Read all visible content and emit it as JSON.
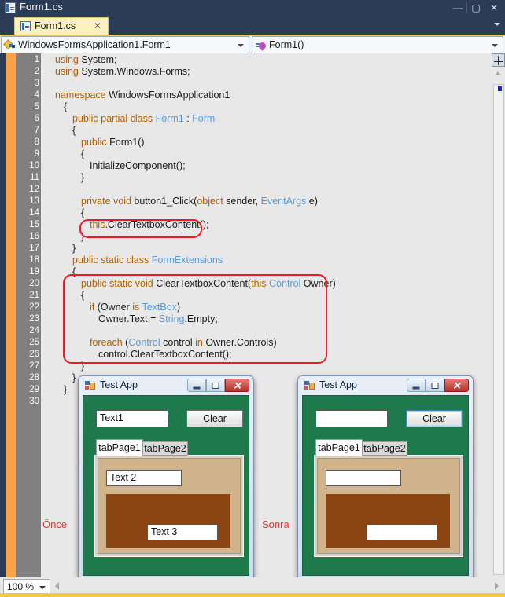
{
  "window": {
    "title": "Form1.cs",
    "icon": "csharp-file-icon",
    "controls": {
      "minimize": "—",
      "maximize": "▢",
      "close": "✕"
    }
  },
  "tabstrip": {
    "tabs": [
      {
        "label": "Form1.cs",
        "close": "✕",
        "icon": "csharp-file-icon"
      }
    ],
    "overflow": "chevron-down-icon"
  },
  "navbar": {
    "class_combo": {
      "value": "WindowsFormsApplication1.Form1",
      "icon": "class-icon"
    },
    "member_combo": {
      "value": "Form1()",
      "icon": "method-icon"
    }
  },
  "editor": {
    "zoom": "100 %",
    "lines": [
      {
        "n": "1",
        "indent": 0,
        "tokens": [
          {
            "t": "using ",
            "c": "kw"
          },
          {
            "t": "System;",
            "c": "pl"
          }
        ]
      },
      {
        "n": "2",
        "indent": 0,
        "tokens": [
          {
            "t": "using ",
            "c": "kw"
          },
          {
            "t": "System.Windows.Forms;",
            "c": "pl"
          }
        ]
      },
      {
        "n": "3",
        "indent": 0,
        "tokens": []
      },
      {
        "n": "4",
        "indent": 0,
        "tokens": [
          {
            "t": "namespace ",
            "c": "kw"
          },
          {
            "t": "WindowsFormsApplication1",
            "c": "pl"
          }
        ]
      },
      {
        "n": "5",
        "indent": 1,
        "tokens": [
          {
            "t": "{",
            "c": "pl"
          }
        ]
      },
      {
        "n": "6",
        "indent": 2,
        "tokens": [
          {
            "t": "public partial class ",
            "c": "kw"
          },
          {
            "t": "Form1",
            "c": "ty"
          },
          {
            "t": " : ",
            "c": "pl"
          },
          {
            "t": "Form",
            "c": "ty"
          }
        ]
      },
      {
        "n": "7",
        "indent": 2,
        "tokens": [
          {
            "t": "{",
            "c": "pl"
          }
        ]
      },
      {
        "n": "8",
        "indent": 3,
        "tokens": [
          {
            "t": "public ",
            "c": "kw"
          },
          {
            "t": "Form1()",
            "c": "pl"
          }
        ]
      },
      {
        "n": "9",
        "indent": 3,
        "tokens": [
          {
            "t": "{",
            "c": "pl"
          }
        ]
      },
      {
        "n": "10",
        "indent": 4,
        "tokens": [
          {
            "t": "InitializeComponent();",
            "c": "pl"
          }
        ]
      },
      {
        "n": "11",
        "indent": 3,
        "tokens": [
          {
            "t": "}",
            "c": "pl"
          }
        ]
      },
      {
        "n": "12",
        "indent": 0,
        "tokens": []
      },
      {
        "n": "13",
        "indent": 3,
        "tokens": [
          {
            "t": "private void ",
            "c": "kw"
          },
          {
            "t": "button1_Click(",
            "c": "pl"
          },
          {
            "t": "object",
            "c": "kw"
          },
          {
            "t": " sender, ",
            "c": "pl"
          },
          {
            "t": "EventArgs",
            "c": "ty"
          },
          {
            "t": " e)",
            "c": "pl"
          }
        ]
      },
      {
        "n": "14",
        "indent": 3,
        "tokens": [
          {
            "t": "{",
            "c": "pl"
          }
        ]
      },
      {
        "n": "15",
        "indent": 4,
        "tokens": [
          {
            "t": "this",
            "c": "kw"
          },
          {
            "t": ".ClearTextboxContent();",
            "c": "pl"
          }
        ]
      },
      {
        "n": "16",
        "indent": 3,
        "tokens": [
          {
            "t": "}",
            "c": "pl"
          }
        ]
      },
      {
        "n": "17",
        "indent": 2,
        "tokens": [
          {
            "t": "}",
            "c": "pl"
          }
        ]
      },
      {
        "n": "18",
        "indent": 2,
        "tokens": [
          {
            "t": "public static class ",
            "c": "kw"
          },
          {
            "t": "FormExtensions",
            "c": "ty"
          }
        ]
      },
      {
        "n": "19",
        "indent": 2,
        "tokens": [
          {
            "t": "{",
            "c": "pl"
          }
        ]
      },
      {
        "n": "20",
        "indent": 3,
        "tokens": [
          {
            "t": "public static void ",
            "c": "kw"
          },
          {
            "t": "ClearTextboxContent(",
            "c": "pl"
          },
          {
            "t": "this ",
            "c": "kw"
          },
          {
            "t": "Control",
            "c": "ty"
          },
          {
            "t": " Owner)",
            "c": "pl"
          }
        ]
      },
      {
        "n": "21",
        "indent": 3,
        "tokens": [
          {
            "t": "{",
            "c": "pl"
          }
        ]
      },
      {
        "n": "22",
        "indent": 4,
        "tokens": [
          {
            "t": "if ",
            "c": "kw"
          },
          {
            "t": "(Owner ",
            "c": "pl"
          },
          {
            "t": "is ",
            "c": "kw"
          },
          {
            "t": "TextBox",
            "c": "ty"
          },
          {
            "t": ")",
            "c": "pl"
          }
        ]
      },
      {
        "n": "23",
        "indent": 5,
        "tokens": [
          {
            "t": "Owner.Text = ",
            "c": "pl"
          },
          {
            "t": "String",
            "c": "ty"
          },
          {
            "t": ".Empty;",
            "c": "pl"
          }
        ]
      },
      {
        "n": "24",
        "indent": 0,
        "tokens": []
      },
      {
        "n": "25",
        "indent": 4,
        "tokens": [
          {
            "t": "foreach ",
            "c": "kw"
          },
          {
            "t": "(",
            "c": "pl"
          },
          {
            "t": "Control",
            "c": "ty"
          },
          {
            "t": " control ",
            "c": "pl"
          },
          {
            "t": "in",
            "c": "kw"
          },
          {
            "t": " Owner.Controls)",
            "c": "pl"
          }
        ]
      },
      {
        "n": "26",
        "indent": 5,
        "tokens": [
          {
            "t": "control.ClearTextboxContent();",
            "c": "pl"
          }
        ]
      },
      {
        "n": "27",
        "indent": 3,
        "tokens": [
          {
            "t": "}",
            "c": "pl"
          }
        ]
      },
      {
        "n": "28",
        "indent": 2,
        "tokens": [
          {
            "t": "}",
            "c": "pl"
          }
        ]
      },
      {
        "n": "29",
        "indent": 1,
        "tokens": [
          {
            "t": "}",
            "c": "pl"
          }
        ]
      },
      {
        "n": "30",
        "indent": 0,
        "tokens": []
      }
    ]
  },
  "annotations": {
    "before_label": "Önce",
    "after_label": "Sonra",
    "highlight_color": "#ed1c24"
  },
  "app_before": {
    "title": "Test App",
    "textbox1": "Text1",
    "clear_button": "Clear",
    "tabs": [
      "tabPage1",
      "tabPage2"
    ],
    "textbox2": "Text 2",
    "textbox3": "Text 3"
  },
  "app_after": {
    "title": "Test App",
    "textbox1": "",
    "clear_button": "Clear",
    "tabs": [
      "tabPage1",
      "tabPage2"
    ],
    "textbox2": "",
    "textbox3": ""
  }
}
